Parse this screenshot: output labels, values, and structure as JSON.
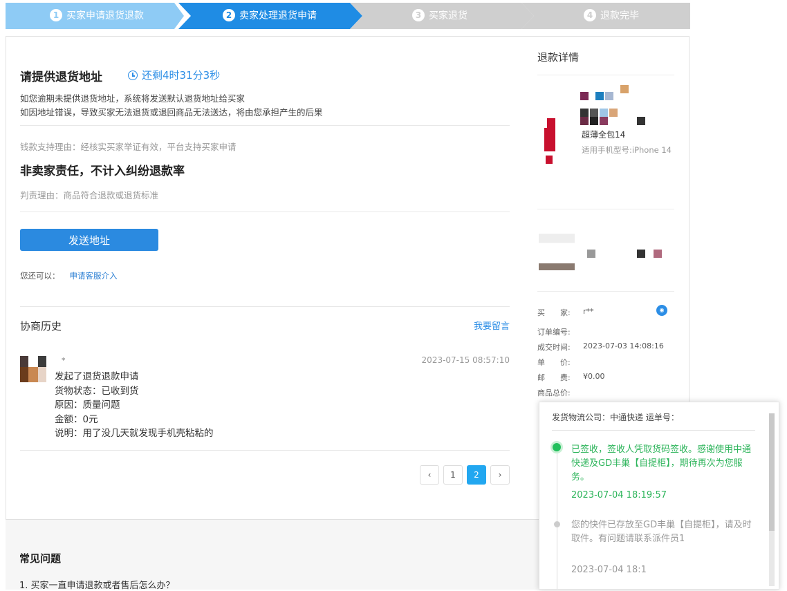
{
  "steps": [
    {
      "num": "1",
      "label": "买家申请退货退款"
    },
    {
      "num": "2",
      "label": "卖家处理退货申请"
    },
    {
      "num": "3",
      "label": "买家退货"
    },
    {
      "num": "4",
      "label": "退款完毕"
    }
  ],
  "main": {
    "title": "请提供退货地址",
    "countdown": "还剩4时31分3秒",
    "note1": "如您逾期未提供退货地址，系统将发送默认退货地址给买家",
    "note2": "如因地址错误，导致买家无法退货或退回商品无法送达，将由您承担产生的后果",
    "support_reason": "钱款支持理由：经核实买家举证有效，平台支持买家申请",
    "verdict": "非卖家责任，不计入纠纷退款率",
    "judge_reason": "判责理由：商品符合退款或退货标准",
    "send_button": "发送地址",
    "also_label": "您还可以：",
    "also_link": "申请客服介入"
  },
  "history": {
    "title": "协商历史",
    "leave_message": "我要留言",
    "entry": {
      "user": "*",
      "time": "2023-07-15 08:57:10",
      "lines": [
        "发起了退货退款申请",
        "货物状态：已收到货",
        "原因：质量问题",
        "金额：0元",
        "说明：用了没几天就发现手机壳粘粘的"
      ]
    },
    "pagination": {
      "prev": "‹",
      "pages": [
        "1",
        "2"
      ],
      "current": "2",
      "next": "›"
    }
  },
  "side": {
    "title": "退款详情",
    "product_name": "超薄全包14",
    "product_model": "适用手机型号:iPhone 14",
    "fields": [
      {
        "label": "买　　家:",
        "value": "r**"
      },
      {
        "label": "订单编号:",
        "value": ""
      },
      {
        "label": "成交时间:",
        "value": "2023-07-03 14:08:16"
      },
      {
        "label": "单　　价:",
        "value": ""
      },
      {
        "label": "邮　　费:",
        "value": "¥0.00"
      },
      {
        "label": "商品总价:",
        "value": ""
      }
    ]
  },
  "faq": {
    "title": "常见问题",
    "item1": "1. 买家一直申请退款或者售后怎么办？"
  },
  "logistics": {
    "header": "发货物流公司：中通快递  运单号：",
    "events": [
      {
        "text": "已签收，签收人凭取货码签收。感谢使用中通快递及GD丰巢【自提柜】，期待再次为您服务。",
        "time": "2023-07-04 18:19:57"
      },
      {
        "text": "您的快件已存放至GD丰巢【自提柜】，请及时取件。有问题请联系派件员1",
        "time": "2023-07-04 18:1"
      }
    ]
  },
  "colors": {
    "primary": "#1f8ce4",
    "step_done": "#8ecbf5",
    "step_todo": "#cfcfcf",
    "success": "#2cb45a"
  }
}
